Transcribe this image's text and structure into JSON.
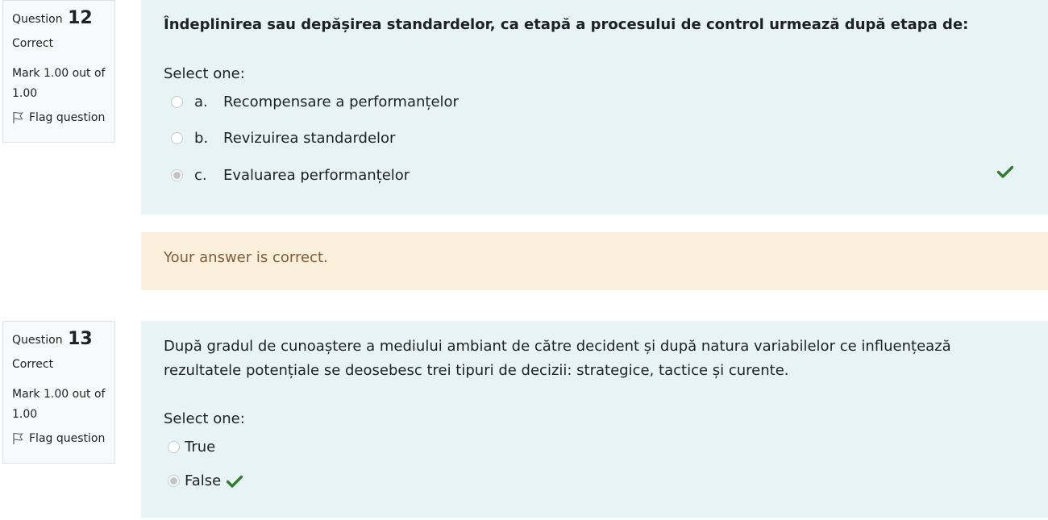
{
  "questions": [
    {
      "label": "Question",
      "number": "12",
      "state": "Correct",
      "grade": "Mark 1.00 out of 1.00",
      "flag_label": "Flag question",
      "text": "Îndeplinirea sau depășirea standardelor, ca etapă a procesului de control urmează după etapa de:",
      "prompt": "Select one:",
      "options": [
        {
          "letter": "a.",
          "text": "Recompensare a performanțelor",
          "selected": false
        },
        {
          "letter": "b.",
          "text": "Revizuirea standardelor",
          "selected": false
        },
        {
          "letter": "c.",
          "text": "Evaluarea performanțelor",
          "selected": true,
          "correct": true
        }
      ],
      "feedback": "Your answer is correct."
    },
    {
      "label": "Question",
      "number": "13",
      "state": "Correct",
      "grade": "Mark 1.00 out of 1.00",
      "flag_label": "Flag question",
      "text": "După gradul de cunoaștere a mediului ambiant de către decident și după natura variabilelor ce influențează rezultatele potențiale se deosebesc trei tipuri de decizii: strategice, tactice și curente.",
      "prompt": "Select one:",
      "options": [
        {
          "text": "True",
          "selected": false
        },
        {
          "text": "False",
          "selected": true,
          "correct": true
        }
      ]
    }
  ],
  "colors": {
    "correct_check": "#357a32",
    "feedback_bg": "#fcefdc",
    "feedback_text": "#7e5d3a",
    "formulation_bg": "#e7f3f5"
  },
  "icons": {
    "flag": "flag-icon",
    "check": "check-icon"
  }
}
